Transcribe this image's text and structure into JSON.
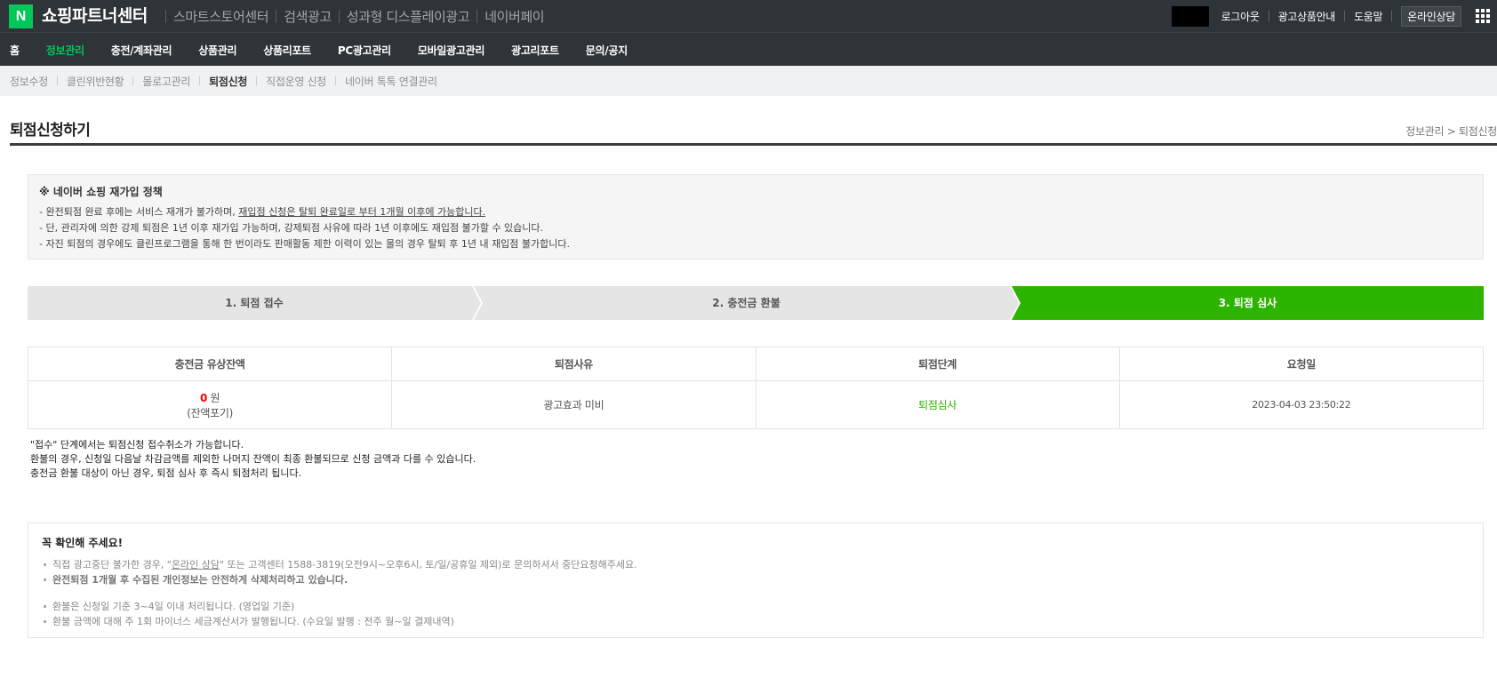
{
  "topbar": {
    "logo": "N",
    "brand": "쇼핑파트너센터",
    "nav": [
      "스마트스토어센터",
      "검색광고",
      "성과형 디스플레이광고",
      "네이버페이"
    ],
    "logout": "로그아웃",
    "ad_product_guide": "광고상품안내",
    "help": "도움말",
    "online_consult": "온라인상담"
  },
  "mainnav": {
    "items": [
      "홈",
      "정보관리",
      "충전/계좌관리",
      "상품관리",
      "상품리포트",
      "PC광고관리",
      "모바일광고관리",
      "광고리포트",
      "문의/공지"
    ],
    "active_index": 1
  },
  "subnav": {
    "items": [
      "정보수정",
      "클린위반현황",
      "몰로고관리",
      "퇴점신청",
      "직접운영 신청",
      "네이버 톡톡 연결관리"
    ],
    "active_index": 3
  },
  "page": {
    "title": "퇴점신청하기",
    "breadcrumb": "정보관리 > 퇴점신청"
  },
  "policy": {
    "heading": "※ 네이버 쇼핑 재가입 정책",
    "line1_pre": "- 완전퇴점 완료 후에는 서비스 재개가 불가하며, ",
    "line1_underline": "재입점 신청은 탈퇴 완료일로 부터 1개월 이후에 가능합니다.",
    "line2": "- 단, 관리자에 의한 강제 퇴점은 1년 이후 재가입 가능하며, 강제퇴점 사유에 따라 1년 이후에도 재입점 불가할 수 있습니다.",
    "line3": "- 자진 퇴점의 경우에도 클린프로그램을 통해 한 번이라도 판매활동 제한 이력이 있는 몰의 경우 탈퇴 후 1년 내 재입점 불가합니다."
  },
  "steps": [
    "1. 퇴점 접수",
    "2. 충전금 환불",
    "3. 퇴점 심사"
  ],
  "table": {
    "headers": [
      "충전금 유상잔액",
      "퇴점사유",
      "퇴점단계",
      "요청일"
    ],
    "balance_value": "0",
    "balance_unit": " 원",
    "balance_note": "(잔액포기)",
    "reason": "광고효과 미비",
    "stage": "퇴점심사",
    "date": "2023-04-03 23:50:22"
  },
  "notes": [
    "\"접수\" 단계에서는 퇴점신청 접수취소가 가능합니다.",
    "환불의 경우, 신청일 다음날 차감금액를 제외한 나머지 잔액이 최종 환불되므로 신청 금액과 다를 수 있습니다.",
    "충전금 환불 대상이 아닌 경우, 퇴점 심사 후 즉시 퇴점처리 됩니다."
  ],
  "confirm": {
    "heading": "꼭 확인해 주세요!",
    "line1_pre": "직접 광고중단 불가한 경우, \"",
    "line1_link": "온라인 상담",
    "line1_post": "\" 또는 고객센터 1588-3819(오전9시~오후6시, 토/일/공휴일 제외)로 문의하셔서 중단요청해주세요.",
    "line2": "완전퇴점 1개월 후 수집된 개인정보는 안전하게 삭제처리하고 있습니다.",
    "line3": "환불은 신청일 기준 3~4일 이내 처리됩니다. (영업일 기준)",
    "line4": "환불 금액에 대해 주 1회 마이너스 세금계산서가 발행됩니다. (수요일 발행 : 전주 월~일 결제내역)"
  }
}
